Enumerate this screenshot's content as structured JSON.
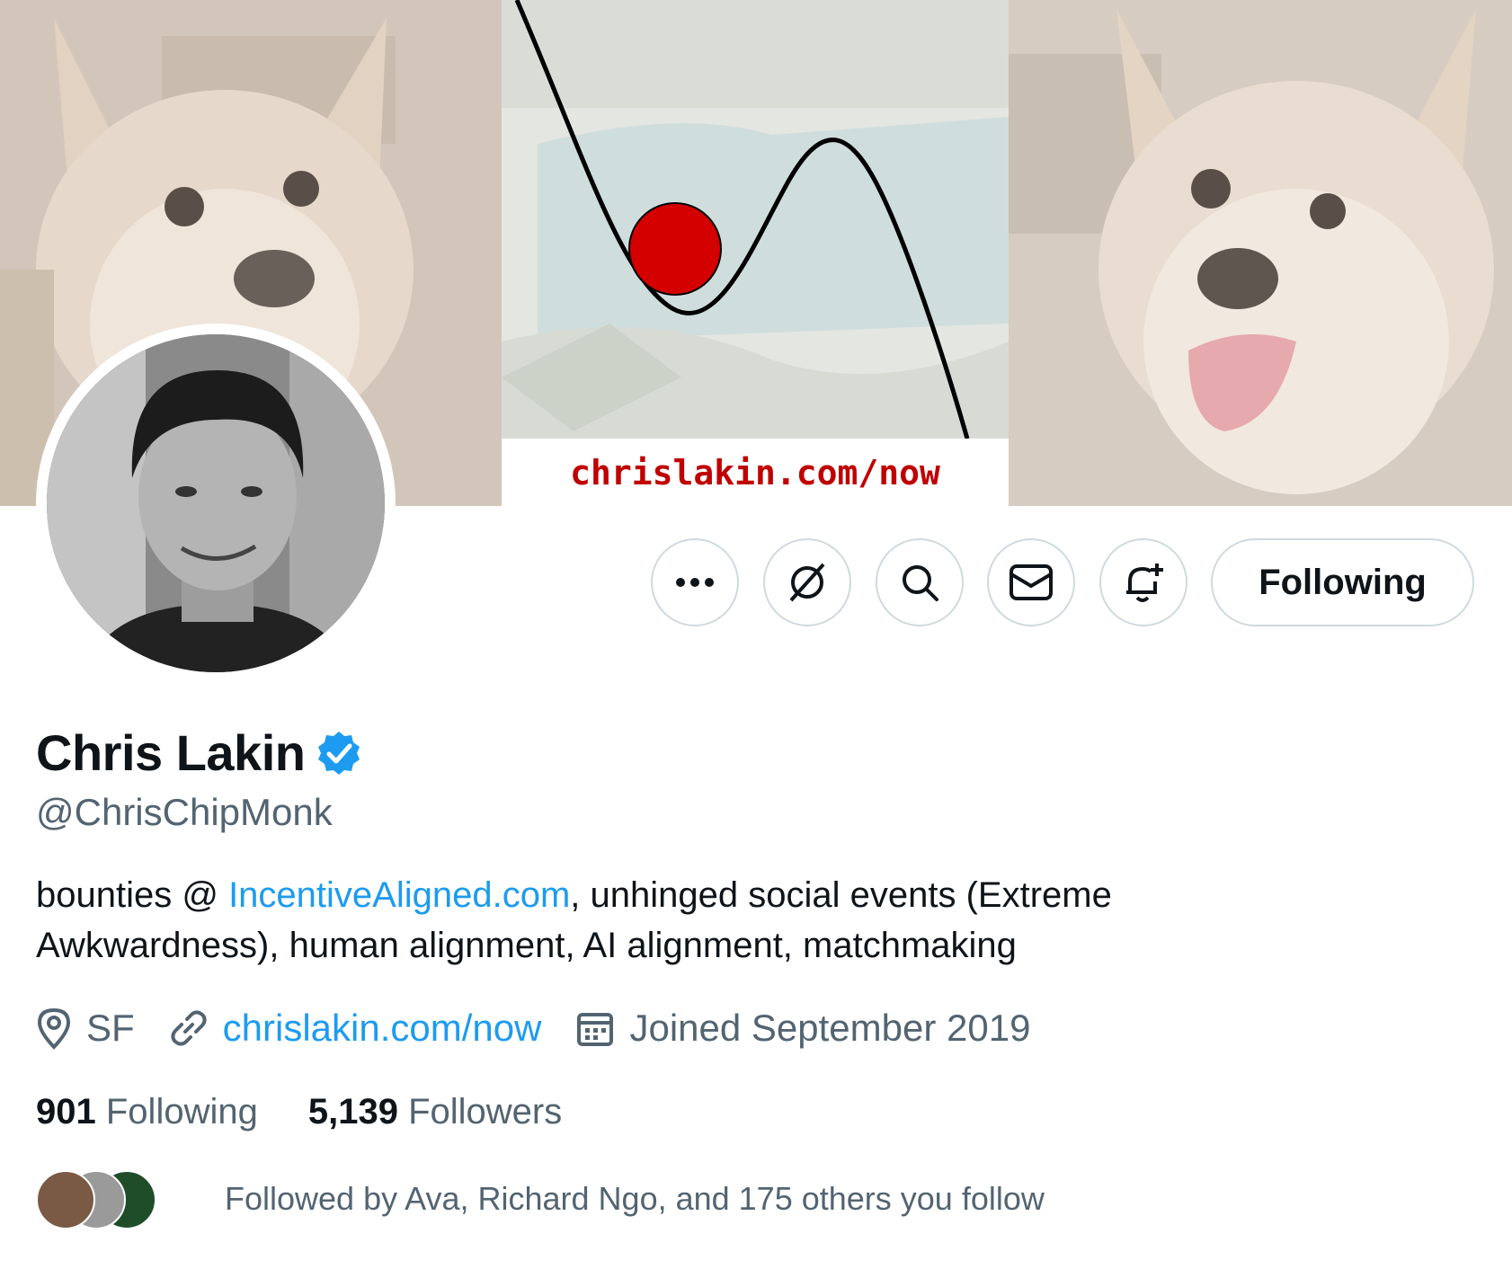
{
  "banner": {
    "caption": "chrislakin.com/now",
    "left_image_icon": "dog-photo-icon",
    "center_image_icon": "ball-in-valley-diagram-icon",
    "right_image_icon": "dog-photo-icon"
  },
  "profile": {
    "avatar_icon": "profile-photo-icon",
    "display_name": "Chris Lakin",
    "verified_icon": "verified-badge-icon",
    "handle": "@ChrisChipMonk",
    "bio": {
      "prefix": "bounties @ ",
      "link": "IncentiveAligned.com",
      "suffix": ", unhinged social events (Extreme Awkwardness), human alignment, AI alignment, matchmaking"
    },
    "location": "SF",
    "website": "chrislakin.com/now",
    "joined": "Joined September 2019",
    "following_count": "901",
    "following_label": "Following",
    "followers_count": "5,139",
    "followers_label": "Followers",
    "followed_by": "Followed by Ava, Richard Ngo, and 175 others you follow"
  },
  "actions": {
    "more_icon": "more-icon",
    "grok_icon": "grok-icon",
    "search_icon": "search-icon",
    "message_icon": "mail-icon",
    "notify_icon": "bell-plus-icon",
    "follow_label": "Following"
  },
  "colors": {
    "accent": "#1d9bf0",
    "text_primary": "#0f1419",
    "text_secondary": "#536471",
    "border": "#cfd9de",
    "banner_caption": "#c00000",
    "ball": "#d40000"
  }
}
